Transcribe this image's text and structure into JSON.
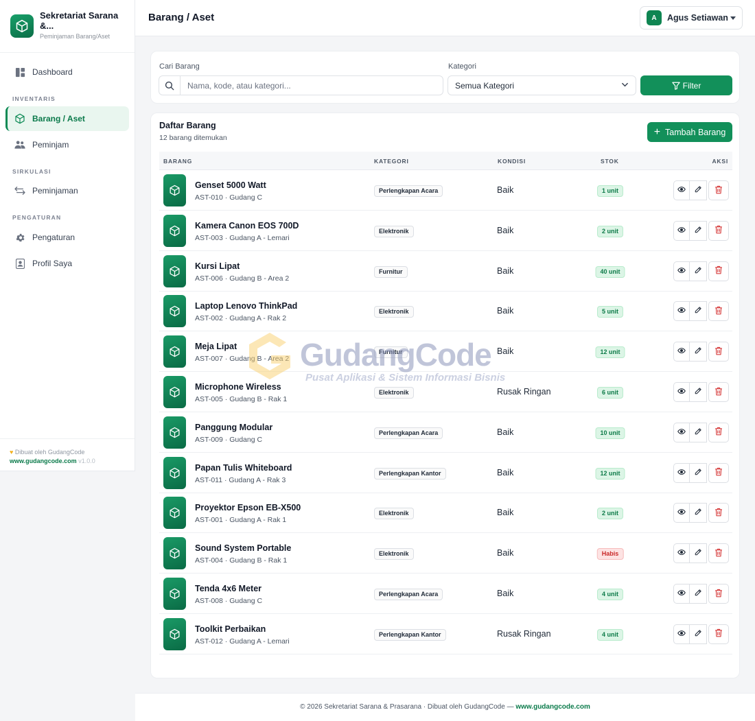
{
  "sidebar": {
    "brand_title": "Sekretariat Sarana &...",
    "brand_subtitle": "Peminjaman Barang/Aset",
    "sections": [
      "INVENTARIS",
      "SIRKULASI",
      "PENGATURAN"
    ],
    "items": [
      {
        "label": "Dashboard",
        "icon": "dashboard-icon"
      },
      {
        "label": "Barang / Aset",
        "icon": "box-icon",
        "active": true
      },
      {
        "label": "Peminjam",
        "icon": "users-icon"
      },
      {
        "label": "Peminjaman",
        "icon": "transfer-icon"
      },
      {
        "label": "Pengaturan",
        "icon": "gear-icon"
      },
      {
        "label": "Profil Saya",
        "icon": "profile-icon"
      }
    ],
    "footer": {
      "made_by": "Dibuat oleh GudangCode",
      "url": "www.gudangcode.com",
      "version": "v1.0.0"
    }
  },
  "header": {
    "title": "Barang / Aset",
    "user_initial": "A",
    "user_name": "Agus Setiawan"
  },
  "filter": {
    "search_label": "Cari Barang",
    "search_placeholder": "Nama, kode, atau kategori...",
    "category_label": "Kategori",
    "category_value": "Semua Kategori",
    "filter_button": "Filter"
  },
  "list": {
    "title": "Daftar Barang",
    "count_text": "12 barang ditemukan",
    "add_button": "Tambah Barang",
    "columns": [
      "BARANG",
      "KATEGORI",
      "KONDISI",
      "STOK",
      "AKSI"
    ],
    "rows": [
      {
        "name": "Genset 5000 Watt",
        "meta": "AST-010 · Gudang C",
        "category": "Perlengkapan Acara",
        "condition": "Baik",
        "stock": "1 unit",
        "status": "ok"
      },
      {
        "name": "Kamera Canon EOS 700D",
        "meta": "AST-003 · Gudang A - Lemari",
        "category": "Elektronik",
        "condition": "Baik",
        "stock": "2 unit",
        "status": "ok"
      },
      {
        "name": "Kursi Lipat",
        "meta": "AST-006 · Gudang B - Area 2",
        "category": "Furnitur",
        "condition": "Baik",
        "stock": "40 unit",
        "status": "ok"
      },
      {
        "name": "Laptop Lenovo ThinkPad",
        "meta": "AST-002 · Gudang A - Rak 2",
        "category": "Elektronik",
        "condition": "Baik",
        "stock": "5 unit",
        "status": "ok"
      },
      {
        "name": "Meja Lipat",
        "meta": "AST-007 · Gudang B - Area 2",
        "category": "Furnitur",
        "condition": "Baik",
        "stock": "12 unit",
        "status": "ok"
      },
      {
        "name": "Microphone Wireless",
        "meta": "AST-005 · Gudang B - Rak 1",
        "category": "Elektronik",
        "condition": "Rusak Ringan",
        "stock": "6 unit",
        "status": "ok"
      },
      {
        "name": "Panggung Modular",
        "meta": "AST-009 · Gudang C",
        "category": "Perlengkapan Acara",
        "condition": "Baik",
        "stock": "10 unit",
        "status": "ok"
      },
      {
        "name": "Papan Tulis Whiteboard",
        "meta": "AST-011 · Gudang A - Rak 3",
        "category": "Perlengkapan Kantor",
        "condition": "Baik",
        "stock": "12 unit",
        "status": "ok"
      },
      {
        "name": "Proyektor Epson EB-X500",
        "meta": "AST-001 · Gudang A - Rak 1",
        "category": "Elektronik",
        "condition": "Baik",
        "stock": "2 unit",
        "status": "ok"
      },
      {
        "name": "Sound System Portable",
        "meta": "AST-004 · Gudang B - Rak 1",
        "category": "Elektronik",
        "condition": "Baik",
        "stock": "Habis",
        "status": "out"
      },
      {
        "name": "Tenda 4x6 Meter",
        "meta": "AST-008 · Gudang C",
        "category": "Perlengkapan Acara",
        "condition": "Baik",
        "stock": "4 unit",
        "status": "ok"
      },
      {
        "name": "Toolkit Perbaikan",
        "meta": "AST-012 · Gudang A - Lemari",
        "category": "Perlengkapan Kantor",
        "condition": "Rusak Ringan",
        "stock": "4 unit",
        "status": "ok"
      }
    ]
  },
  "watermark": {
    "title": "GudangCode",
    "subtitle": "Pusat Aplikasi & Sistem Informasi Bisnis"
  },
  "footer": {
    "text": "© 2026 Sekretariat Sarana & Prasarana · Dibuat oleh GudangCode — ",
    "link": "www.gudangcode.com"
  },
  "colors": {
    "primary": "#12905a",
    "active_bg": "#e9f6ef",
    "stock_ok": "#dcf5e6",
    "stock_out": "#fde3e3",
    "danger": "#d63b3b"
  }
}
